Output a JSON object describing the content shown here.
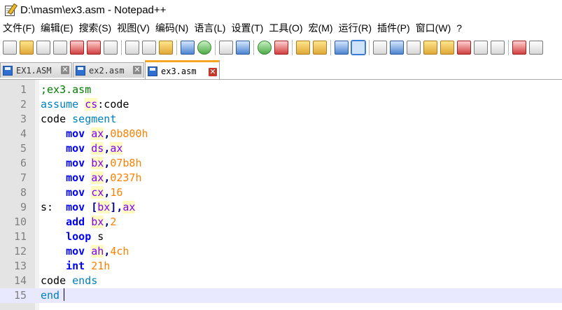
{
  "window": {
    "title": "D:\\masm\\ex3.asm - Notepad++"
  },
  "menu": [
    "文件(F)",
    "编辑(E)",
    "搜索(S)",
    "视图(V)",
    "编码(N)",
    "语言(L)",
    "设置(T)",
    "工具(O)",
    "宏(M)",
    "运行(R)",
    "插件(P)",
    "窗口(W)",
    "?"
  ],
  "toolbar_icons": [
    "new-file-icon",
    "open-file-icon",
    "save-icon",
    "save-all-icon",
    "close-icon",
    "close-all-icon",
    "print-icon",
    "cut-icon",
    "copy-icon",
    "paste-icon",
    "undo-icon",
    "redo-icon",
    "find-icon",
    "replace-icon",
    "zoom-in-icon",
    "zoom-out-icon",
    "sync-v-icon",
    "sync-h-icon",
    "word-wrap-icon",
    "show-all-chars-icon",
    "indent-guide-icon",
    "doc-map-icon",
    "function-list-icon",
    "folder-workspace-icon",
    "doc-list-icon",
    "monitor-icon",
    "record-macro-icon",
    "stop-macro-icon"
  ],
  "tabs": [
    {
      "label": "EX1.ASM",
      "active": false
    },
    {
      "label": "ex2.asm",
      "active": false
    },
    {
      "label": "ex3.asm",
      "active": true
    }
  ],
  "editor": {
    "current_line": 15,
    "lines": [
      {
        "n": "1",
        "t": [
          [
            ";ex3.asm",
            "cm"
          ]
        ]
      },
      {
        "n": "2",
        "t": [
          [
            "assume",
            "dir"
          ],
          [
            " ",
            "txt"
          ],
          [
            "cs",
            "reg"
          ],
          [
            ":code",
            "txt"
          ]
        ]
      },
      {
        "n": "3",
        "t": [
          [
            "code ",
            "txt"
          ],
          [
            "segment",
            "dir"
          ]
        ]
      },
      {
        "n": "4",
        "t": [
          [
            "    ",
            "txt"
          ],
          [
            "mov",
            "kw"
          ],
          [
            " ",
            "txt"
          ],
          [
            "ax",
            "reg"
          ],
          [
            ",",
            "op"
          ],
          [
            "0b800h",
            "num"
          ]
        ]
      },
      {
        "n": "5",
        "t": [
          [
            "    ",
            "txt"
          ],
          [
            "mov",
            "kw"
          ],
          [
            " ",
            "txt"
          ],
          [
            "ds",
            "reg"
          ],
          [
            ",",
            "op"
          ],
          [
            "ax",
            "reg"
          ]
        ]
      },
      {
        "n": "6",
        "t": [
          [
            "    ",
            "txt"
          ],
          [
            "mov",
            "kw"
          ],
          [
            " ",
            "txt"
          ],
          [
            "bx",
            "reg"
          ],
          [
            ",",
            "op"
          ],
          [
            "07b8h",
            "num"
          ]
        ]
      },
      {
        "n": "7",
        "t": [
          [
            "    ",
            "txt"
          ],
          [
            "mov",
            "kw"
          ],
          [
            " ",
            "txt"
          ],
          [
            "ax",
            "reg"
          ],
          [
            ",",
            "op"
          ],
          [
            "0237h",
            "num"
          ]
        ]
      },
      {
        "n": "8",
        "t": [
          [
            "    ",
            "txt"
          ],
          [
            "mov",
            "kw"
          ],
          [
            " ",
            "txt"
          ],
          [
            "cx",
            "reg"
          ],
          [
            ",",
            "op"
          ],
          [
            "16",
            "num"
          ]
        ]
      },
      {
        "n": "9",
        "t": [
          [
            "s:  ",
            "txt"
          ],
          [
            "mov",
            "kw"
          ],
          [
            " ",
            "txt"
          ],
          [
            "[",
            "op"
          ],
          [
            "bx",
            "reg"
          ],
          [
            "]",
            "op"
          ],
          [
            ",",
            "op"
          ],
          [
            "ax",
            "reg"
          ]
        ]
      },
      {
        "n": "10",
        "t": [
          [
            "    ",
            "txt"
          ],
          [
            "add",
            "kw"
          ],
          [
            " ",
            "txt"
          ],
          [
            "bx",
            "reg"
          ],
          [
            ",",
            "op"
          ],
          [
            "2",
            "num"
          ]
        ]
      },
      {
        "n": "11",
        "t": [
          [
            "    ",
            "txt"
          ],
          [
            "loop",
            "kw"
          ],
          [
            " s",
            "txt"
          ]
        ]
      },
      {
        "n": "12",
        "t": [
          [
            "    ",
            "txt"
          ],
          [
            "mov",
            "kw"
          ],
          [
            " ",
            "txt"
          ],
          [
            "ah",
            "reg"
          ],
          [
            ",",
            "op"
          ],
          [
            "4ch",
            "num"
          ]
        ]
      },
      {
        "n": "13",
        "t": [
          [
            "    ",
            "txt"
          ],
          [
            "int",
            "kw"
          ],
          [
            " ",
            "txt"
          ],
          [
            "21h",
            "num"
          ]
        ]
      },
      {
        "n": "14",
        "t": [
          [
            "code ",
            "txt"
          ],
          [
            "ends",
            "dir"
          ]
        ]
      },
      {
        "n": "15",
        "t": [
          [
            "end",
            "dir"
          ]
        ]
      }
    ]
  }
}
